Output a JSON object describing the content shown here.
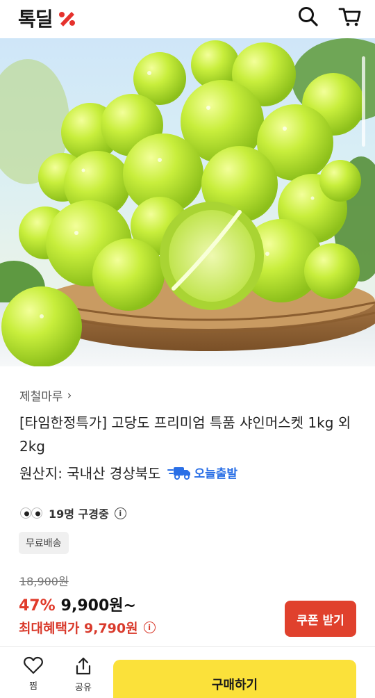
{
  "header": {
    "logo_text": "톡딜",
    "logo_mark_icon": "percent-mark-icon",
    "search_icon": "search-icon",
    "cart_icon": "cart-icon"
  },
  "hero": {
    "alt_subject": "shine-muscat-grapes-in-basket"
  },
  "product": {
    "seller": "제철마루",
    "seller_chevron": "›",
    "title": "[타임한정특가] 고당도 프리미엄 특품 샤인머스켓 1kg 외 2kg",
    "origin": "원산지: 국내산 경상북도",
    "badge_today": "오늘출발",
    "viewers": "19명 구경중",
    "free_shipping": "무료배송",
    "original_price": "18,900원",
    "discount": "47%",
    "sale_price": "9,900원~",
    "max_benefit": "최대혜택가 9,790원",
    "coupon_label": "쿠폰 받기",
    "info_glyph": "i"
  },
  "bottom_bar": {
    "like_label": "찜",
    "share_label": "공유",
    "buy_label": "구매하기"
  },
  "colors": {
    "accent_red": "#e03b2b",
    "coupon_bg": "#e0412d",
    "buy_bg": "#fbe13a",
    "today_blue": "#2a6fe6"
  }
}
